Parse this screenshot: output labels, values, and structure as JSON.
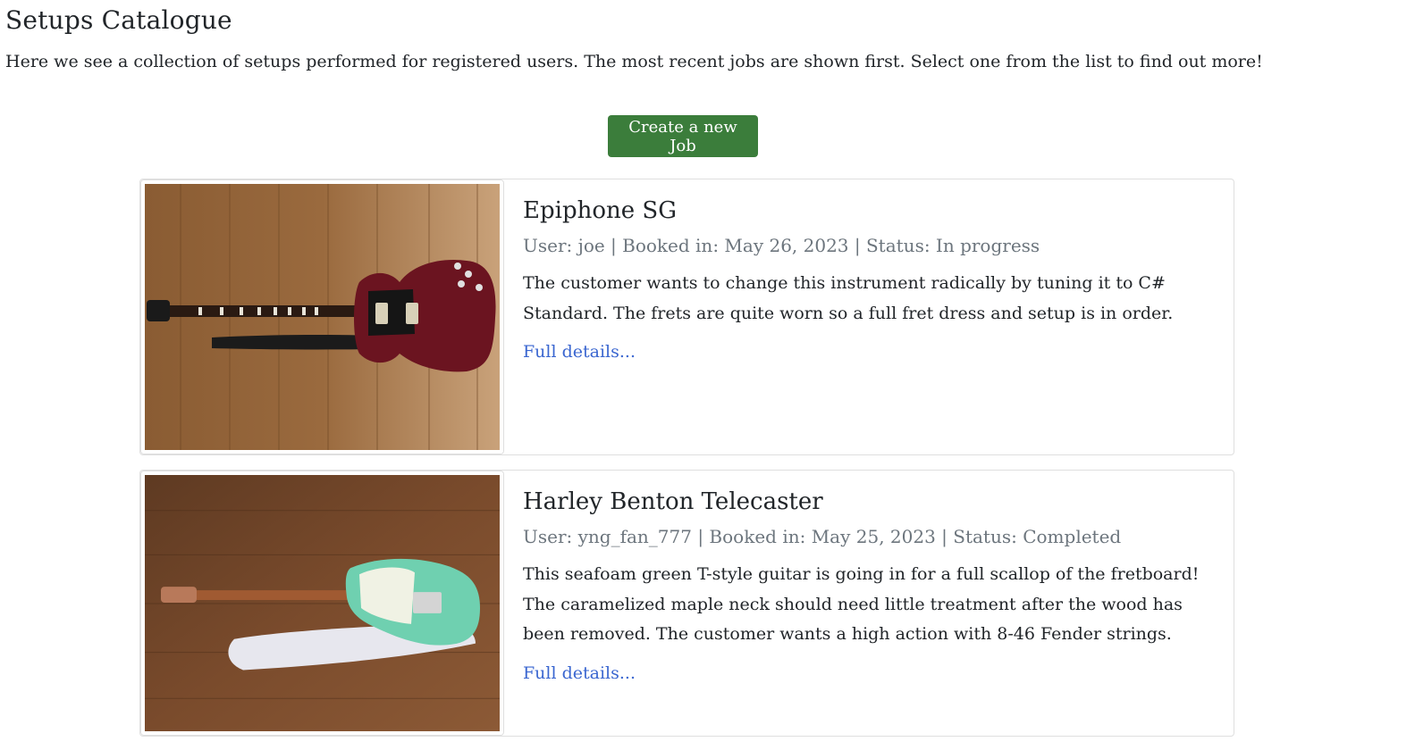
{
  "page": {
    "title": "Setups Catalogue",
    "intro": "Here we see a collection of setups performed for registered users. The most recent jobs are shown first. Select one from the list to find out more!"
  },
  "actions": {
    "create_label": "Create a new Job"
  },
  "jobs": [
    {
      "title": "Epiphone SG",
      "meta": "User: joe | Booked in: May 26, 2023 | Status: In progress",
      "description": "The customer wants to change this instrument radically by tuning it to C# Standard. The frets are quite worn so a full fret dress and setup is in order.",
      "link_label": "Full details...",
      "guitar_color": "#6b1420"
    },
    {
      "title": "Harley Benton Telecaster",
      "meta": "User: yng_fan_777 | Booked in: May 25, 2023 | Status: Completed",
      "description": "This seafoam green T-style guitar is going in for a full scallop of the fretboard! The caramelized maple neck should need little treatment after the wood has been removed. The customer wants a high action with 8-46 Fender strings.",
      "link_label": "Full details...",
      "guitar_color": "#6fd0b0"
    }
  ],
  "colors": {
    "button": "#3b7d3b",
    "link": "#3a66d0",
    "muted": "#6c757d"
  }
}
